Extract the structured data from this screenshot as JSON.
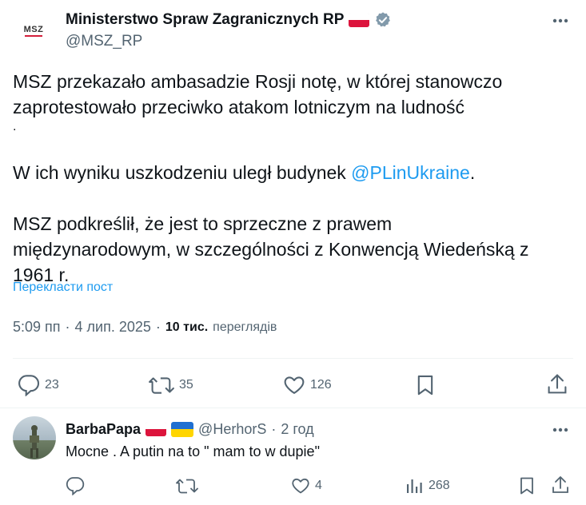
{
  "post": {
    "author_name": "Ministerstwo Spraw Zagranicznych RP",
    "author_handle": "@MSZ_RP",
    "avatar_text": "MSZ",
    "more_icon": "more-dots-icon",
    "verified_icon": "verified-badge-icon",
    "text": {
      "p1_part1": "MSZ przekazało ambasadzie Rosji notę, w której stanowczo",
      "p1_part2": "zaprotestowało przeciwko atakom lotniczym na ludność",
      "p1_tail": ".",
      "p2_before": "W ich wyniku uszkodzeniu uległ budynek ",
      "p2_mention": "@PLinUkraine",
      "p2_after": ".",
      "p3_line1": "MSZ podkreślił, że jest to sprzeczne z prawem",
      "p3_line2": "międzynarodowym, w szczególności z Konwencją Wiedeńską z",
      "p3_line3": "1961 r."
    },
    "translate_label": "Перекласти пост",
    "meta": {
      "time": "5:09 пп",
      "sep1": "·",
      "date": "4 лип. 2025",
      "sep2": "·",
      "views_count": "10 тис.",
      "views_label": "переглядів"
    },
    "actions": {
      "reply_count": "23",
      "repost_count": "35",
      "like_count": "126"
    }
  },
  "reply": {
    "author_name": "BarbaPapa",
    "author_handle": "@HerhorS",
    "sep": "·",
    "time": "2 год",
    "text": "Mocne . A putin na to \" mam to w dupie\"",
    "actions": {
      "like_count": "4",
      "views_count": "268"
    }
  },
  "colors": {
    "text": "#0f1419",
    "muted": "#536471",
    "link": "#1d9bf0",
    "divider": "#eff3f4",
    "verified": "#829aab",
    "msz_red": "#d31f3b"
  }
}
